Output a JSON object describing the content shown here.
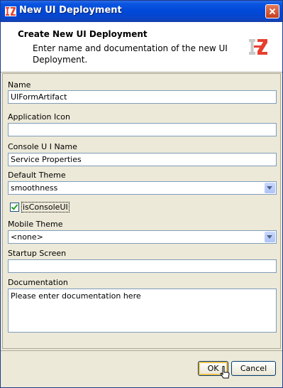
{
  "window": {
    "title": "New UI Deployment",
    "close_icon": "close-icon"
  },
  "header": {
    "title": "Create New UI Deployment",
    "subtitle": "Enter name and documentation of the new UI Deployment.",
    "logo_icon": "i2-logo-icon"
  },
  "form": {
    "name_label": "Name",
    "name_value": "UIFormArtifact",
    "app_icon_label": "Application Icon",
    "app_icon_value": "",
    "console_label": "Console U I Name",
    "console_value": "Service Properties",
    "theme_label": "Default Theme",
    "theme_value": "smoothness",
    "is_console_label": "isConsoleUI",
    "is_console_checked": true,
    "mobile_label": "Mobile Theme",
    "mobile_value": "<none>",
    "startup_label": "Startup Screen",
    "startup_value": "",
    "doc_label": "Documentation",
    "doc_value": "Please enter documentation here"
  },
  "buttons": {
    "ok": "OK",
    "cancel": "Cancel"
  },
  "colors": {
    "titlebar": "#0048d8",
    "dialog_bg": "#ece9d8",
    "logo_red": "#e63f2e"
  }
}
